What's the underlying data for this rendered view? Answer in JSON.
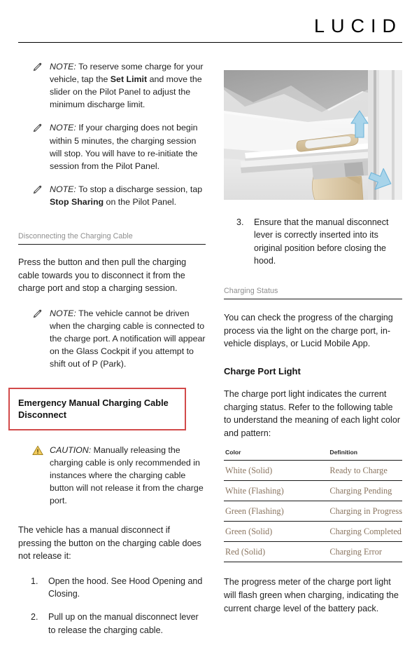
{
  "header": {
    "brand": "LUCID"
  },
  "left_column": {
    "notes": [
      {
        "icon": "pencil-icon",
        "lead": "NOTE:",
        "segments": [
          {
            "text": " To reserve some charge for your vehicle, tap the ",
            "bold": false
          },
          {
            "text": "Set Limit",
            "bold": true
          },
          {
            "text": " and move the slider on the Pilot Panel to adjust the minimum discharge limit.",
            "bold": false
          }
        ]
      },
      {
        "icon": "pencil-icon",
        "lead": "NOTE:",
        "segments": [
          {
            "text": " If your charging does not begin within 5 minutes, the charging session will stop. You will have to re-initiate the session from the Pilot Panel.",
            "bold": false
          }
        ]
      },
      {
        "icon": "pencil-icon",
        "lead": "NOTE:",
        "segments": [
          {
            "text": " To stop a discharge session, tap ",
            "bold": false
          },
          {
            "text": "Stop Sharing",
            "bold": true
          },
          {
            "text": " on the Pilot Panel.",
            "bold": false
          }
        ]
      }
    ],
    "section_heading": "Disconnecting the Charging Cable",
    "paragraph": "Press the button and then pull the charging cable towards you to disconnect it from the charge port and stop a charging session.",
    "note_4": {
      "icon": "pencil-icon",
      "lead": "NOTE:",
      "text": " The vehicle cannot be driven when the charging cable is connected to the charge port. A notification will appear on the Glass Cockpit if you attempt to shift out of P (Park)."
    },
    "boxed_heading": "Emergency Manual Charging Cable Disconnect",
    "boxed_heading_border_color": "#d24a4a",
    "caution": {
      "icon": "warning-triangle-icon",
      "lead": "CAUTION:",
      "text": " Manually releasing the charging cable is only recommended in instances where the charging cable button will not release it from the charge port."
    },
    "paragraph_2": "The vehicle has a manual disconnect if pressing the button on the charging cable does not release it:",
    "steps": [
      {
        "num": "1.",
        "text": "Open the hood. See Hood Opening and Closing."
      },
      {
        "num": "2.",
        "text": "Pull up on the manual disconnect lever to release the charging cable."
      }
    ]
  },
  "right_column": {
    "illustration_alt": "manual-disconnect-lever-photo",
    "step_3": {
      "num": "3.",
      "text": "Ensure that the manual disconnect lever is correctly inserted into its original position before closing the hood."
    },
    "section_heading": "Charging Status",
    "paragraph": "You can check the progress of the charging process via the light on the charge port, in-vehicle displays, or Lucid Mobile App.",
    "sub_heading": "Charge Port Light",
    "paragraph_2": "The charge port light indicates the current charging status. Refer to the following table to understand the meaning of each light color and pattern:",
    "table": {
      "headers": [
        "Color",
        "Definition"
      ],
      "rows": [
        [
          "White (Solid)",
          "Ready to Charge"
        ],
        [
          "White (Flashing)",
          "Charging Pending"
        ],
        [
          "Green (Flashing)",
          "Charging in Progress"
        ],
        [
          "Green (Solid)",
          "Charging Completed"
        ],
        [
          "Red (Solid)",
          "Charging Error"
        ]
      ],
      "text_color": "#8a7560"
    },
    "paragraph_3": "The progress meter of the charge port light will flash green when charging, indicating the current charge level of the battery pack."
  }
}
